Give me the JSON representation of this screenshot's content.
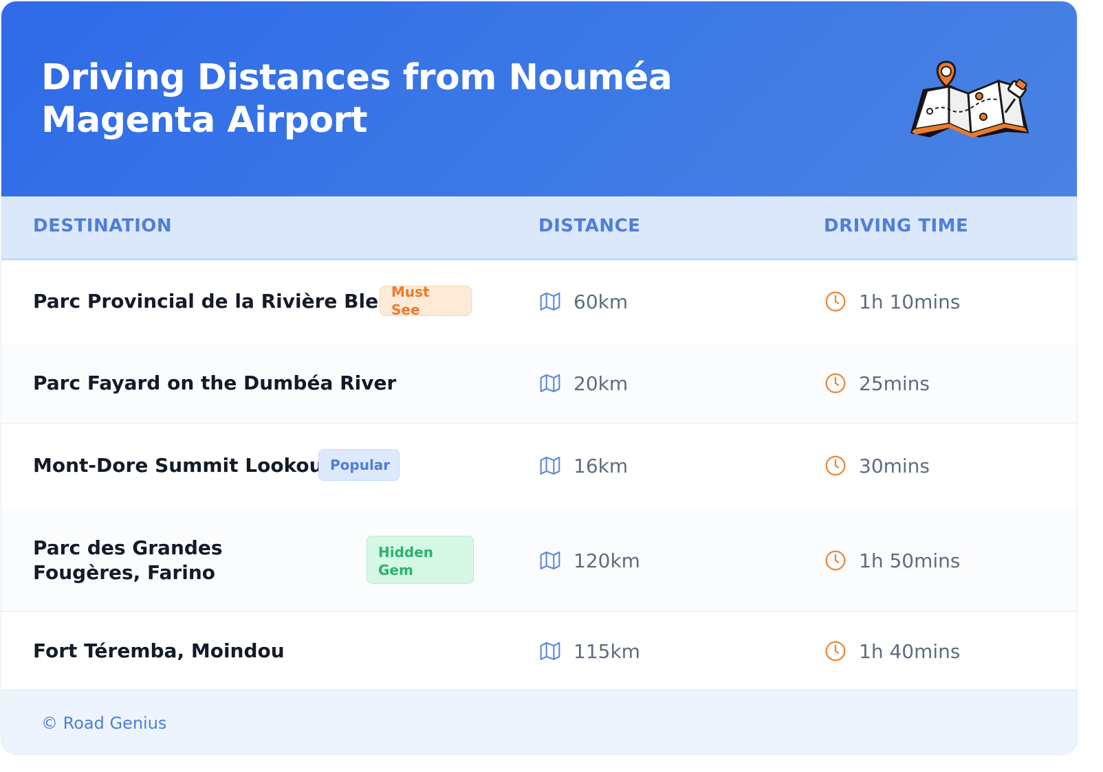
{
  "header": {
    "title": "Driving Distances from Nouméa Magenta Airport"
  },
  "table": {
    "columns": [
      "DESTINATION",
      "DISTANCE",
      "DRIVING TIME"
    ],
    "rows": [
      {
        "destination": "Parc Provincial de la Rivière Bleue",
        "badge": "Must See",
        "distance": "60km",
        "time": "1h 10mins"
      },
      {
        "destination": "Parc Fayard on the Dumbéa River",
        "badge": "",
        "distance": "20km",
        "time": "25mins"
      },
      {
        "destination": "Mont-Dore Summit Lookout",
        "badge": "Popular",
        "distance": "16km",
        "time": "30mins"
      },
      {
        "destination": "Parc des Grandes Fougères, Farino",
        "badge": "Hidden Gem",
        "distance": "120km",
        "time": "1h 50mins"
      },
      {
        "destination": "Fort Téremba, Moindou",
        "badge": "",
        "distance": "115km",
        "time": "1h 40mins"
      }
    ]
  },
  "footer": {
    "credit": "© Road Genius"
  },
  "colors": {
    "header": "#2f6ae8",
    "accent": "#4f7fd6",
    "must_see": "#ee7a2a",
    "hidden_gem": "#29b36a",
    "clock": "#ee8a3a"
  },
  "icons": {
    "header": "map-pin-icon",
    "distance": "map-icon",
    "time": "clock-icon"
  }
}
